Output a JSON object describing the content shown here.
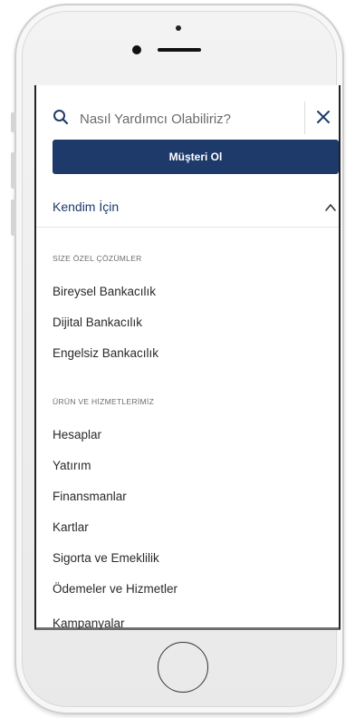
{
  "search": {
    "placeholder": "Nasıl Yardımcı Olabiliriz?"
  },
  "cta": {
    "label": "Müşteri Ol"
  },
  "section": {
    "label": "Kendim İçin"
  },
  "groups": [
    {
      "title": "SİZE ÖZEL ÇÖZÜMLER",
      "items": [
        "Bireysel Bankacılık",
        "Dijital Bankacılık",
        "Engelsiz Bankacılık"
      ]
    },
    {
      "title": "ÜRÜN VE HİZMETLERİMİZ",
      "items": [
        "Hesaplar",
        "Yatırım",
        "Finansmanlar",
        "Kartlar",
        "Sigorta ve Emeklilik",
        "Ödemeler ve Hizmetler",
        "Kampanyalar"
      ]
    }
  ],
  "colors": {
    "brand": "#1e3a6b",
    "text": "#2a2a2a",
    "muted": "#6c6c6c"
  },
  "icons": {
    "search": "search-icon",
    "close": "close-icon",
    "chevron": "chevron-up-icon"
  }
}
